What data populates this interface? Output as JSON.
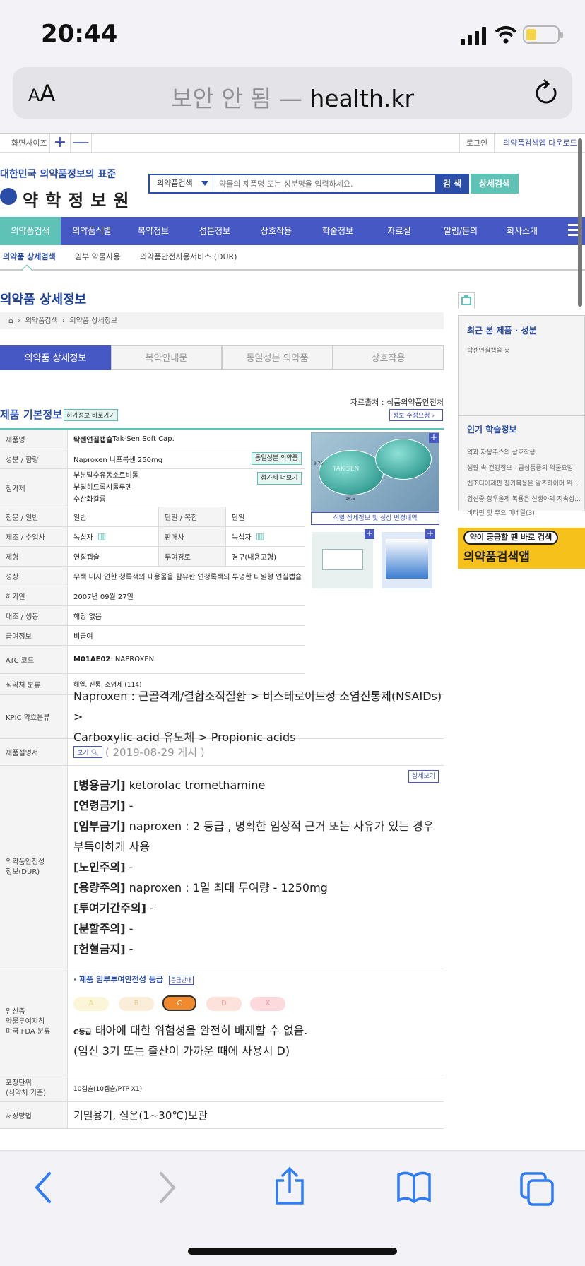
{
  "status": {
    "time": "20:44"
  },
  "browser": {
    "aa_small": "A",
    "aa_big": "A",
    "security": "보안 안 됨 —",
    "host": "health.kr"
  },
  "topstrip": {
    "screen_size": "화면사이즈",
    "zoom_in": "+",
    "zoom_out": "—",
    "login": "로그인",
    "app_download": "의약품검색앱 다운로드"
  },
  "header": {
    "logo_sub": "대한민국 의약품정보의 표준",
    "logo_main": "약학정보원",
    "search_select": "의약품검색",
    "search_placeholder": "약물의 제품명 또는 성분명을 입력하세요.",
    "search_button": "검 색",
    "advanced_button": "상세검색"
  },
  "nav": [
    "의약품검색",
    "의약품식별",
    "복약정보",
    "성분정보",
    "상호작용",
    "학술정보",
    "자료실",
    "알림/문의",
    "회사소개"
  ],
  "subnav": [
    "의약품 상세검색",
    "임부 약물사용",
    "의약품안전사용서비스 (DUR)"
  ],
  "page": {
    "title": "의약품 상세정보",
    "breadcrumb": [
      "의약품검색",
      "의약품 상세정보"
    ]
  },
  "tabs": [
    "의약품 상세정보",
    "복약안내문",
    "동일성분 의약품",
    "상호작용"
  ],
  "info": {
    "source": "자료출처 : 식품의약품안전처",
    "section_title": "제품 기본정보",
    "permit_button": "허가정보 바로가기",
    "edit_request": "정보 수정요청",
    "same_ingredient_button": "동일성분 의약품",
    "more_additive_button": "첨가제 더보기",
    "pill_caption": "식별 상세정보 및 성상 변경내역",
    "pill_imprint": "TAK-SEN",
    "pill_size_v": "9.75",
    "pill_size_h": "16.6",
    "rows": {
      "product_name": {
        "label": "제품명",
        "bold": "탁센연질캡슐",
        "rest": " Tak-Sen Soft Cap."
      },
      "ingredient": {
        "label": "성분 / 함량",
        "value": "Naproxen   나프록센   250mg"
      },
      "additives": {
        "label": "첨가제",
        "values": [
          "부분탈수유동소르비톨",
          "부틸히드록시톨루엔",
          "수산화칼륨"
        ]
      },
      "professional": {
        "label": "전문 / 일반",
        "value": "일반",
        "label2": "단일 / 복합",
        "value2": "단일"
      },
      "maker": {
        "label": "제조 / 수입사",
        "value": "녹십자",
        "label2": "판매사",
        "value2": "녹십자"
      },
      "form": {
        "label": "제형",
        "value": "연질캡슐",
        "label2": "투여경로",
        "value2": "경구(내용고형)"
      },
      "appearance": {
        "label": "성상",
        "value": "무색 내지 연한 청록색의 내용물을 함유한 연청록색의 투명한 타원형 연질캡슐"
      },
      "permit_date": {
        "label": "허가일",
        "value": "2007년 09월 27일"
      },
      "generic": {
        "label": "대조 / 생동",
        "value": "해당 없음"
      },
      "insurance": {
        "label": "급여정보",
        "value": "비급여"
      },
      "atc": {
        "label": "ATC 코드",
        "bold": "M01AE02",
        "rest": " : NAPROXEN"
      },
      "mfds": {
        "label": "식약처 분류",
        "value": "해열, 진통, 소염제 (114)"
      },
      "kpic": {
        "label": "KPIC 약효분류",
        "line1": "Naproxen : 근골격계/결합조직질환 > 비스테로이드성 소염진통제(NSAIDs) >",
        "line2": "Carboxylic acid 유도체 > Propionic acids"
      },
      "leaflet": {
        "label": "제품설명서",
        "button": "보기",
        "date": "( 2019-08-29 게시 )"
      },
      "dur": {
        "label1": "의약품안전성",
        "label2": "정보(DUR)",
        "detail_button": "상세보기",
        "lines": [
          {
            "b": "[병용금기]",
            "t": " ketorolac tromethamine"
          },
          {
            "b": "[연령금기]",
            "t": " -"
          },
          {
            "b": "[임부금기]",
            "t": " naproxen : 2 등급 , 명확한 임상적 근거 또는 사유가 있는 경우"
          },
          {
            "b": "",
            "t": "부득이하게 사용"
          },
          {
            "b": "[노인주의]",
            "t": " -"
          },
          {
            "b": "[용량주의]",
            "t": " naproxen : 1일 최대 투여량 - 1250mg"
          },
          {
            "b": "[투여기간주의]",
            "t": " -"
          },
          {
            "b": "[분할주의]",
            "t": " -"
          },
          {
            "b": "[헌혈금지]",
            "t": " -"
          }
        ]
      },
      "pregnancy": {
        "label1": "임신중",
        "label2": "약물투여지침",
        "label3": "미국 FDA 분류",
        "title": "제품 임부투여안전성 등급",
        "guide_button": "등급안내",
        "grades": [
          "A",
          "B",
          "C",
          "D",
          "X"
        ],
        "selected": "C",
        "grade_tag": "C등급",
        "desc1": " 태아에 대한 위험성을 완전히 배제할 수 없음.",
        "desc2": "(임신 3기 또는 출산이 가까운 때에 사용시 D)"
      },
      "package": {
        "label1": "포장단위",
        "label2": "(식약처 기준)",
        "value": "10캡슐(10캡슐/PTP X1)"
      },
      "storage": {
        "label": "저장방법",
        "value": "기밀용기, 실온(1~30℃)보관"
      }
    }
  },
  "sidebar": {
    "recent_title": "최근 본 제품 · 성분",
    "recent_item": "탁센연질캡슐",
    "recent_remove": "×",
    "popular_title": "인기 학술정보",
    "popular_items": [
      "약과 자몽주스의 상호작용",
      "생활 속 건강정보 - 급성통풍의 약물요법",
      "벤조디아제핀 장기복용은 알츠하이머 위...",
      "임신중 항우울제 복용은 신생아의 지속성...",
      "비타민 및 주요 미네랄(3)"
    ],
    "banner_top": "약이 궁금할 땐 바로 검색",
    "banner_main": "의약품검색앱"
  },
  "colors": {
    "nav": "#4658c4",
    "accent": "#5ec3b6",
    "title": "#1c3f99",
    "grade_c": "#f08a2c"
  }
}
